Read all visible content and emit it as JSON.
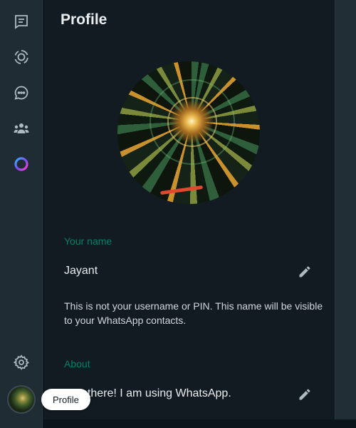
{
  "nav": {
    "items": [
      {
        "icon": "chats-icon"
      },
      {
        "icon": "status-icon"
      },
      {
        "icon": "channels-icon"
      },
      {
        "icon": "communities-icon"
      },
      {
        "icon": "meta-ai-icon"
      }
    ],
    "settings_icon": "gear-icon",
    "profile_tooltip": "Profile"
  },
  "profile": {
    "title": "Profile",
    "name_label": "Your name",
    "name_value": "Jayant",
    "name_note": "This is not your username or PIN. This name will be visible to your WhatsApp contacts.",
    "about_label": "About",
    "about_value": "Hey there! I am using WhatsApp."
  },
  "colors": {
    "accent": "#008069",
    "panel_bg": "#111b21",
    "rail_bg": "#202c33",
    "text_primary": "#e9edef",
    "icon": "#aebac1"
  }
}
